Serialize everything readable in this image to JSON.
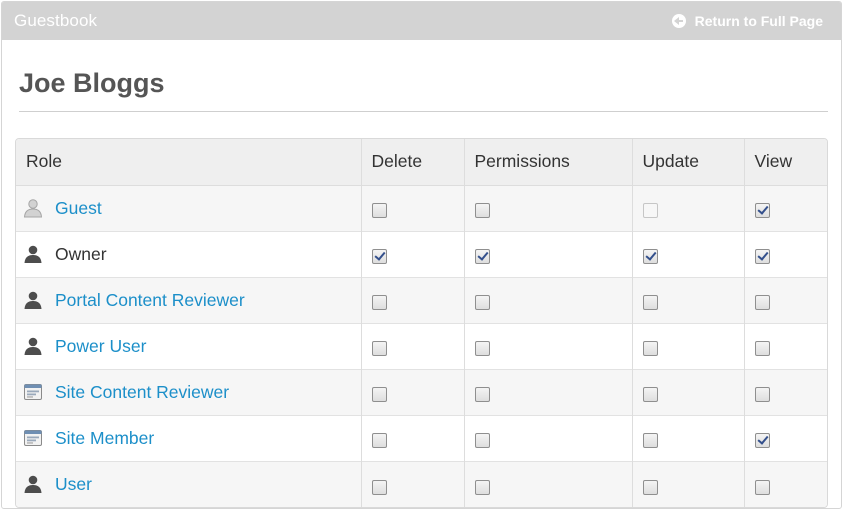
{
  "header": {
    "title": "Guestbook",
    "return_label": "Return to Full Page"
  },
  "page_title": "Joe Bloggs",
  "table": {
    "columns": [
      "Role",
      "Delete",
      "Permissions",
      "Update",
      "View"
    ],
    "rows": [
      {
        "role": "Guest",
        "link": true,
        "icon": "guest-user-icon",
        "delete": false,
        "permissions": false,
        "update": false,
        "update_disabled": true,
        "view": true
      },
      {
        "role": "Owner",
        "link": false,
        "icon": "user-icon",
        "delete": true,
        "permissions": true,
        "update": true,
        "update_disabled": false,
        "view": true
      },
      {
        "role": "Portal Content Reviewer",
        "link": true,
        "icon": "user-icon",
        "delete": false,
        "permissions": false,
        "update": false,
        "update_disabled": false,
        "view": false
      },
      {
        "role": "Power User",
        "link": true,
        "icon": "user-icon",
        "delete": false,
        "permissions": false,
        "update": false,
        "update_disabled": false,
        "view": false
      },
      {
        "role": "Site Content Reviewer",
        "link": true,
        "icon": "site-role-icon",
        "delete": false,
        "permissions": false,
        "update": false,
        "update_disabled": false,
        "view": false
      },
      {
        "role": "Site Member",
        "link": true,
        "icon": "site-role-icon",
        "delete": false,
        "permissions": false,
        "update": false,
        "update_disabled": false,
        "view": true
      },
      {
        "role": "User",
        "link": true,
        "icon": "user-icon",
        "delete": false,
        "permissions": false,
        "update": false,
        "update_disabled": false,
        "view": false
      }
    ]
  },
  "colors": {
    "header_bg": "#d3d3d3",
    "link": "#1c8fc9",
    "heading": "#555555"
  }
}
